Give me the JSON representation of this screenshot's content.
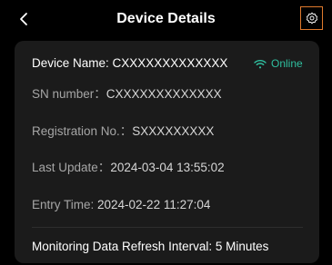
{
  "header": {
    "title": "Device Details",
    "back_icon": "chevron-left-icon",
    "settings_icon": "gear-icon",
    "settings_highlight_color": "#e07a2d"
  },
  "device": {
    "name_label": "Device Name: ",
    "name_value": "CXXXXXXXXXXXXX",
    "status_icon": "wifi-icon",
    "status_text": "Online",
    "status_color": "#2fbf9f",
    "sn_label": "SN number：",
    "sn_value": "CXXXXXXXXXXXXX",
    "reg_label": "Registration No.：",
    "reg_value": "SXXXXXXXXX",
    "update_label": "Last Update：",
    "update_value": "2024-03-04 13:55:02",
    "entry_label": "Entry Time: ",
    "entry_value": "2024-02-22 11:27:04",
    "interval_text": "Monitoring Data Refresh Interval: 5 Minutes"
  }
}
